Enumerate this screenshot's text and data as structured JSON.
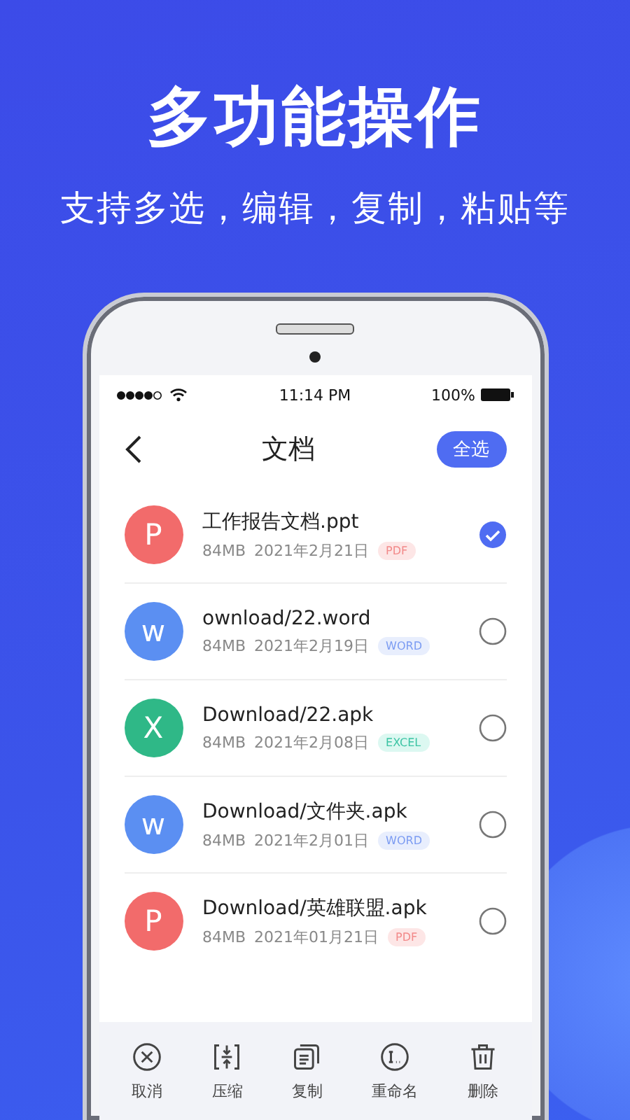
{
  "headline": "多功能操作",
  "subtitle": "支持多选，编辑，复制，粘贴等",
  "status_bar": {
    "time": "11:14 PM",
    "battery": "100%"
  },
  "nav": {
    "title": "文档",
    "action": "全选"
  },
  "files": [
    {
      "letter": "P",
      "color": "#f26b6b",
      "name": "工作报告文档.ppt",
      "size": "84MB",
      "date": "2021年2月21日",
      "tag": {
        "kind": "pdf",
        "label": "PDF"
      },
      "selected": true
    },
    {
      "letter": "w",
      "color": "#5b8ff2",
      "name": "ownload/22.word",
      "size": "84MB",
      "date": "2021年2月19日",
      "tag": {
        "kind": "word",
        "label": "WORD"
      },
      "selected": false
    },
    {
      "letter": "X",
      "color": "#2fb887",
      "name": "Download/22.apk",
      "size": "84MB",
      "date": "2021年2月08日",
      "tag": {
        "kind": "excel",
        "label": "EXCEL"
      },
      "selected": false
    },
    {
      "letter": "w",
      "color": "#5b8ff2",
      "name": "Download/文件夹.apk",
      "size": "84MB",
      "date": "2021年2月01日",
      "tag": {
        "kind": "word",
        "label": "WORD"
      },
      "selected": false
    },
    {
      "letter": "P",
      "color": "#f26b6b",
      "name": "Download/英雄联盟.apk",
      "size": "84MB",
      "date": "2021年01月21日",
      "tag": {
        "kind": "pdf",
        "label": "PDF"
      },
      "selected": false
    }
  ],
  "toolbar": [
    {
      "kind": "cancel",
      "label": "取消"
    },
    {
      "kind": "compress",
      "label": "压缩"
    },
    {
      "kind": "copy",
      "label": "复制"
    },
    {
      "kind": "rename",
      "label": "重命名"
    },
    {
      "kind": "delete",
      "label": "删除"
    }
  ]
}
